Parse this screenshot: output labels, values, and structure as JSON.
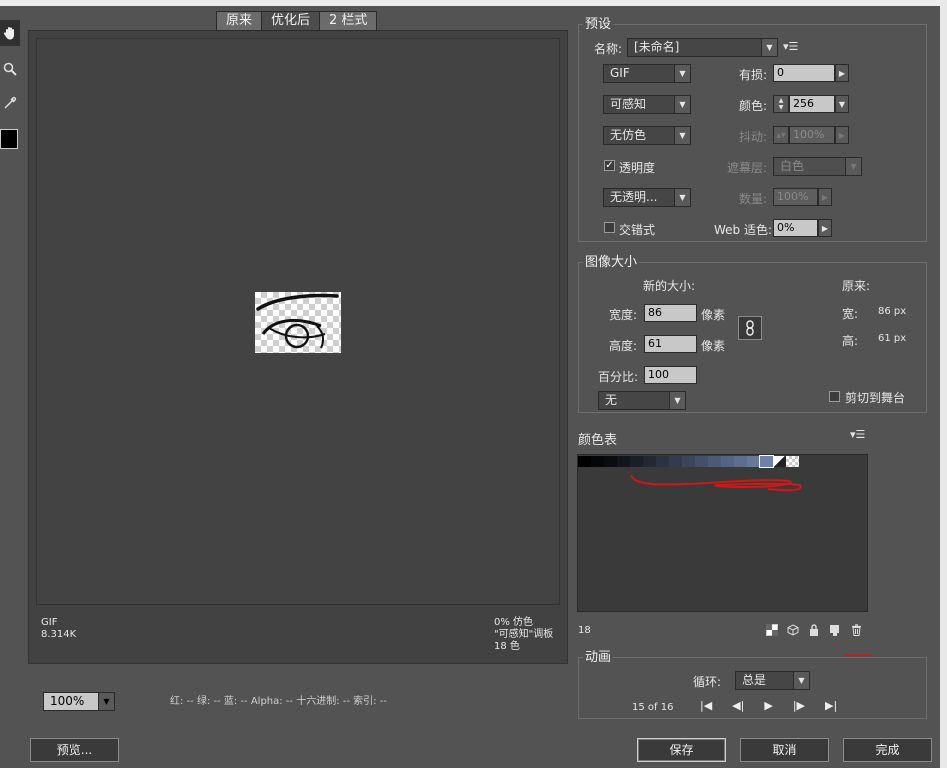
{
  "view_tabs": [
    "原来",
    "优化后",
    "2 栏式"
  ],
  "tools": [
    {
      "name": "hand-icon",
      "glyph": "✋"
    },
    {
      "name": "zoom-icon",
      "glyph": "🔍"
    },
    {
      "name": "eyedropper-icon",
      "glyph": "✎"
    }
  ],
  "preview": {
    "format": "GIF",
    "size": "8.314K",
    "dither_info": "0% 仿色",
    "palette_info": "\"可感知\"调板",
    "color_info": "18 色"
  },
  "zoom": {
    "value": "100%"
  },
  "pixel_info": "红: -- 绿: -- 蓝: -- Alpha: -- 十六进制: -- 索引: --",
  "preset": {
    "legend": "预设",
    "name_label": "名称:",
    "name_value": "[未命名]",
    "format": "GIF",
    "lossy_label": "有损:",
    "lossy_value": "0",
    "reduction": "可感知",
    "colors_label": "颜色:",
    "colors_value": "256",
    "dither": "无仿色",
    "dither_label": "抖动:",
    "dither_value": "100%",
    "transparency_label": "透明度",
    "transparency_checked": true,
    "matte_label": "遮幕层:",
    "matte_value": "白色",
    "transparency_dither": "无透明...",
    "amount_label": "数量:",
    "amount_value": "100%",
    "interlaced_label": "交错式",
    "interlaced_checked": false,
    "web_snap_label": "Web 适色:",
    "web_snap_value": "0%"
  },
  "image_size": {
    "legend": "图像大小",
    "new_size_label": "新的大小:",
    "original_label": "原来:",
    "width_label": "宽度:",
    "width_value": "86",
    "height_label": "高度:",
    "height_value": "61",
    "unit": "像素",
    "orig_width_label": "宽:",
    "orig_width_value": "86 px",
    "orig_height_label": "高:",
    "orig_height_value": "61 px",
    "percent_label": "百分比:",
    "percent_value": "100",
    "quality": "无",
    "clip_label": "剪切到舞台"
  },
  "color_table": {
    "title": "颜色表",
    "count": "18",
    "swatches": [
      "#000000",
      "#050608",
      "#0a0c10",
      "#12151b",
      "#1a1e27",
      "#222834",
      "#2b3241",
      "#333c4e",
      "#3c465b",
      "#445068",
      "#4d5a75",
      "#556482",
      "#5e6e8f",
      "#66789c",
      "#6e82a9"
    ]
  },
  "animation": {
    "legend": "动画",
    "loop_label": "循环:",
    "loop_value": "总是",
    "frame_counter": "15 of 16"
  },
  "buttons": {
    "preview": "预览...",
    "save": "保存",
    "cancel": "取消",
    "done": "完成"
  },
  "colors": {
    "annotation_red": "#d01818",
    "panel_bg": "#535353"
  }
}
